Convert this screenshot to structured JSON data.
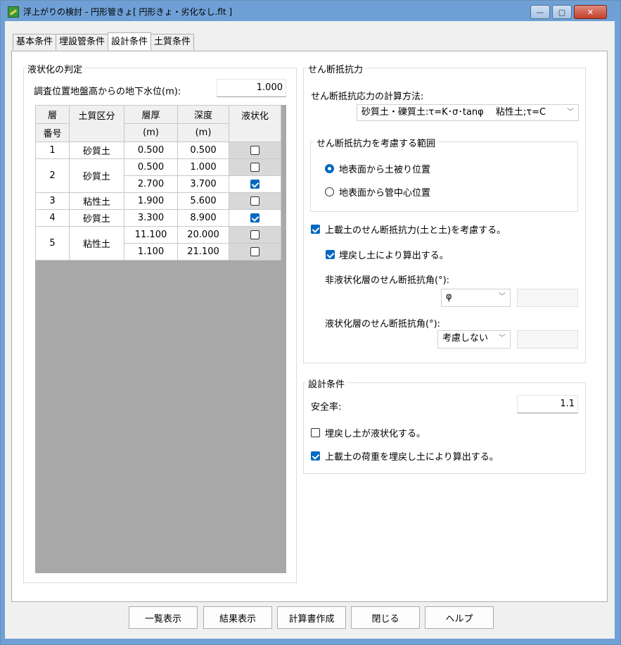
{
  "window": {
    "title": "浮上がりの検討 - 円形管きょ[ 円形きょ・劣化なし.flt ]",
    "min_glyph": "—",
    "max_glyph": "▢",
    "close_glyph": "✕"
  },
  "tabs": [
    "基本条件",
    "埋設管条件",
    "設計条件",
    "土質条件"
  ],
  "liquefaction": {
    "title": "液状化の判定",
    "water_label": "調査位置地盤高からの地下水位(m):",
    "water_value": "1.000",
    "headers": {
      "no_1": "層",
      "no_2": "番号",
      "soil": "土質区分",
      "thick_1": "層厚",
      "thick_2": "(m)",
      "depth_1": "深度",
      "depth_2": "(m)",
      "liq": "液状化"
    },
    "layers": [
      {
        "no": "1",
        "soil": "砂質土",
        "rows": [
          {
            "thick": "0.500",
            "depth": "0.500",
            "liq": false
          }
        ]
      },
      {
        "no": "2",
        "soil": "砂質土",
        "rows": [
          {
            "thick": "0.500",
            "depth": "1.000",
            "liq": false
          },
          {
            "thick": "2.700",
            "depth": "3.700",
            "liq": true
          }
        ]
      },
      {
        "no": "3",
        "soil": "粘性土",
        "rows": [
          {
            "thick": "1.900",
            "depth": "5.600",
            "liq": false
          }
        ]
      },
      {
        "no": "4",
        "soil": "砂質土",
        "rows": [
          {
            "thick": "3.300",
            "depth": "8.900",
            "liq": true
          }
        ]
      },
      {
        "no": "5",
        "soil": "粘性土",
        "rows": [
          {
            "thick": "11.100",
            "depth": "20.000",
            "liq": false
          },
          {
            "thick": "1.100",
            "depth": "21.100",
            "liq": false
          }
        ]
      }
    ]
  },
  "shear": {
    "title": "せん断抵抗力",
    "method_label": "せん断抵抗応力の計算方法:",
    "method_value": "砂質土・礫質土:τ=K･σ･tanφ　 粘性土;τ=C",
    "range_title": "せん断抵抗力を考慮する範囲",
    "radio_cover": "地表面から土被り位置",
    "radio_center": "地表面から管中心位置",
    "consider_overburden": "上載土のせん断抵抗力(土と土)を考慮する。",
    "use_backfill": "埋戻し土により算出する。",
    "nonliq_angle_label": "非液状化層のせん断抵抗角(°):",
    "nonliq_angle_value": "φ",
    "liq_angle_label": "液状化層のせん断抵抗角(°):",
    "liq_angle_value": "考慮しない"
  },
  "design": {
    "title": "設計条件",
    "safety_label": "安全率:",
    "safety_value": "1.1",
    "backfill_liq": "埋戻し土が液状化する。",
    "overburden_load": "上載土の荷重を埋戻し土により算出する。"
  },
  "buttons": {
    "list": "一覧表示",
    "result": "結果表示",
    "report": "計算書作成",
    "close": "閉じる",
    "help": "ヘルプ"
  },
  "colors": {
    "accent": "#0067c0",
    "titlebar": "#6ea0d6",
    "grid_bg": "#a8a8a8"
  }
}
